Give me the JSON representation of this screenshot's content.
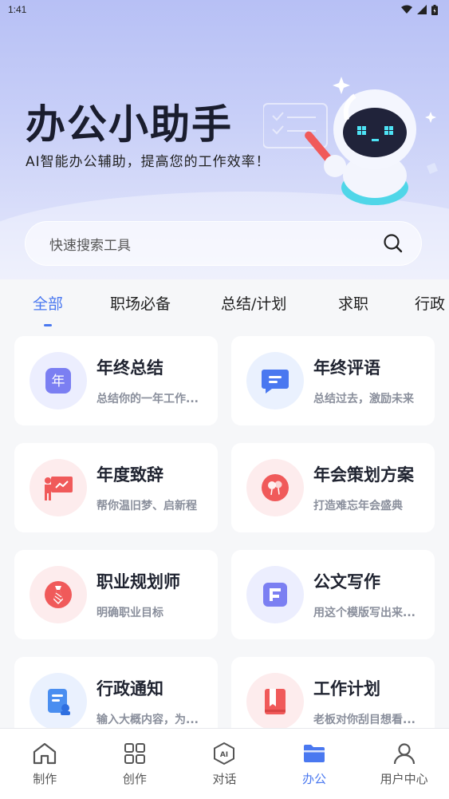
{
  "status_bar": {
    "time": "1:41"
  },
  "hero": {
    "title": "办公小助手",
    "subtitle": "AI智能办公辅助，提高您的工作效率！"
  },
  "search": {
    "placeholder": "快速搜索工具"
  },
  "tabs": [
    {
      "label": "全部",
      "active": true
    },
    {
      "label": "职场必备",
      "active": false
    },
    {
      "label": "总结/计划",
      "active": false
    },
    {
      "label": "求职",
      "active": false
    },
    {
      "label": "行政",
      "active": false
    }
  ],
  "cards": [
    {
      "title": "年终总结",
      "desc": "总结你的一年工作...",
      "icon": "year-badge-icon",
      "color": "#7b7ff2"
    },
    {
      "title": "年终评语",
      "desc": "总结过去，激励未来",
      "icon": "comment-bubble-icon",
      "color": "#4a78f0"
    },
    {
      "title": "年度致辞",
      "desc": "帮你温旧梦、启新程",
      "icon": "presentation-icon",
      "color": "#f05a5a"
    },
    {
      "title": "年会策划方案",
      "desc": "打造难忘年会盛典",
      "icon": "balloons-icon",
      "color": "#f05a5a"
    },
    {
      "title": "职业规划师",
      "desc": "明确职业目标",
      "icon": "tie-icon",
      "color": "#f05a5a"
    },
    {
      "title": "公文写作",
      "desc": "用这个模版写出来...",
      "icon": "document-icon",
      "color": "#7b7ff2"
    },
    {
      "title": "行政通知",
      "desc": "输入大概内容，为...",
      "icon": "notice-icon",
      "color": "#4a8ef0"
    },
    {
      "title": "工作计划",
      "desc": "老板对你刮目想看...",
      "icon": "plan-book-icon",
      "color": "#f05a5a"
    }
  ],
  "bottom_nav": [
    {
      "label": "制作",
      "icon": "home-icon",
      "active": false
    },
    {
      "label": "创作",
      "icon": "grid-icon",
      "active": false
    },
    {
      "label": "对话",
      "icon": "ai-chat-icon",
      "active": false
    },
    {
      "label": "办公",
      "icon": "folder-icon",
      "active": true
    },
    {
      "label": "用户中心",
      "icon": "user-icon",
      "active": false
    }
  ],
  "colors": {
    "accent": "#4a78f0",
    "red": "#f05a5a",
    "purple": "#7b7ff2"
  }
}
